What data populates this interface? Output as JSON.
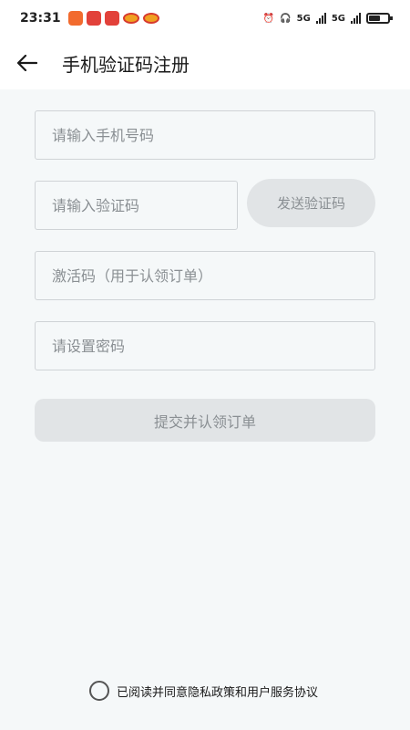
{
  "status_bar": {
    "time": "23:31",
    "network_1": "5G",
    "network_2": "5G"
  },
  "header": {
    "title": "手机验证码注册",
    "back_icon": "arrow-left-icon"
  },
  "form": {
    "phone_placeholder": "请输入手机号码",
    "code_placeholder": "请输入验证码",
    "send_code_label": "发送验证码",
    "activation_placeholder": "激活码（用于认领订单）",
    "password_placeholder": "请设置密码",
    "submit_label": "提交并认领订单"
  },
  "agreement": {
    "text": "已阅读并同意隐私政策和用户服务协议",
    "checked": false
  },
  "colors": {
    "background": "#f5f8f9",
    "disabled_button": "#e1e4e6",
    "placeholder": "#8a8f93"
  }
}
